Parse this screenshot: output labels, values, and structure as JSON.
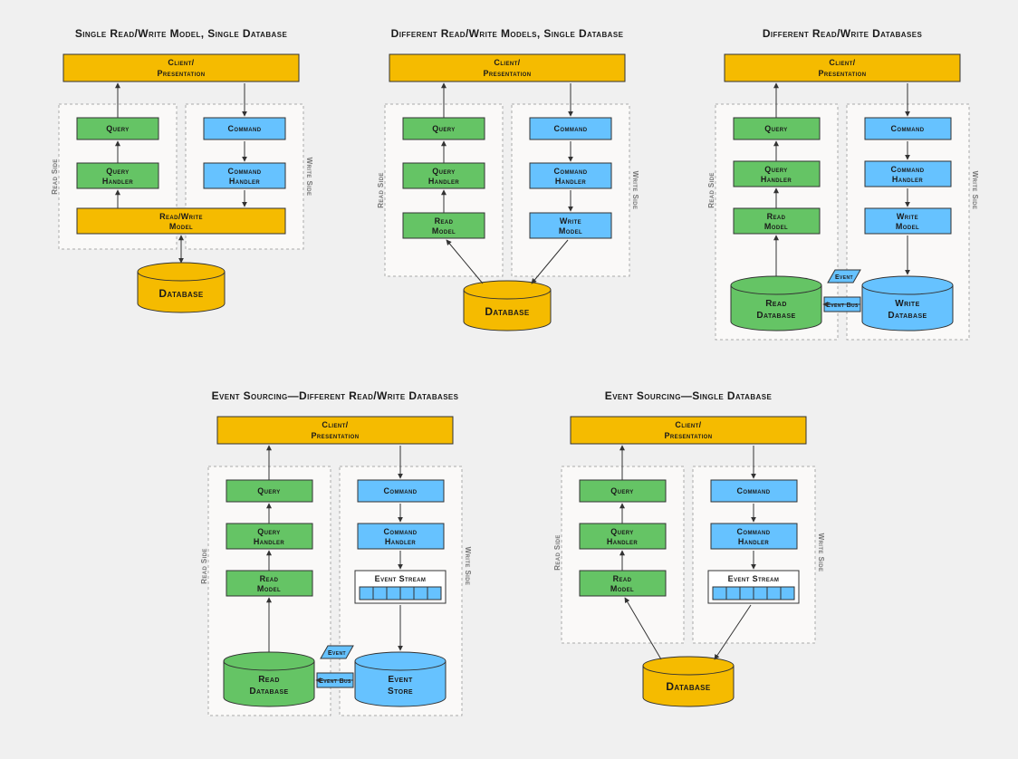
{
  "labels": {
    "client_presentation_line1": "Client/",
    "client_presentation_line2": "Presentation",
    "query": "Query",
    "query_handler_line1": "Query",
    "query_handler_line2": "Handler",
    "command": "Command",
    "command_handler_line1": "Command",
    "command_handler_line2": "Handler",
    "read_write_model_line1": "Read/Write",
    "read_write_model_line2": "Model",
    "read_model_line1": "Read",
    "read_model_line2": "Model",
    "write_model_line1": "Write",
    "write_model_line2": "Model",
    "database": "Database",
    "read_database_line1": "Read",
    "read_database_line2": "Database",
    "write_database_line1": "Write",
    "write_database_line2": "Database",
    "event_store_line1": "Event",
    "event_store_line2": "Store",
    "event": "Event",
    "event_bus": "Event Bus",
    "event_stream": "Event Stream",
    "read_side": "Read Side",
    "write_side": "Write Side"
  },
  "diagrams": {
    "d1": {
      "title": "Single Read/Write Model, Single Database"
    },
    "d2": {
      "title": "Different Read/Write Models, Single Database"
    },
    "d3": {
      "title": "Different Read/Write Databases"
    },
    "d4": {
      "title": "Event Sourcing—Different Read/Write Databases"
    },
    "d5": {
      "title": "Event Sourcing—Single Database"
    }
  },
  "colors": {
    "yellow": "#f5bb00",
    "green": "#65c465",
    "blue": "#66c2ff",
    "background": "#f0f0f0"
  }
}
